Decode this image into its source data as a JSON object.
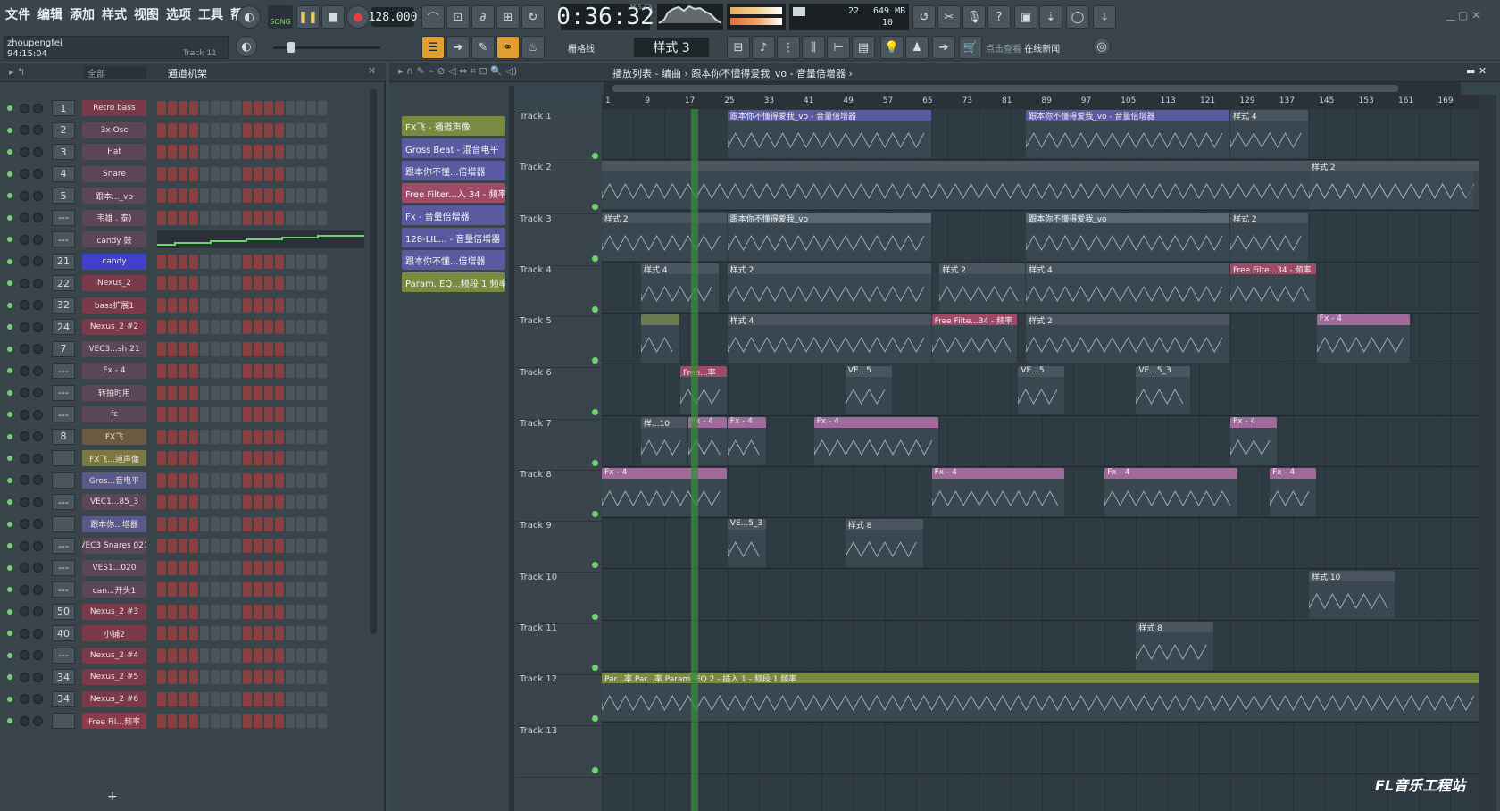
{
  "menu": [
    "文件",
    "编辑",
    "添加",
    "样式",
    "视图",
    "选项",
    "工具",
    "帮助"
  ],
  "user": {
    "name": "zhoupengfei",
    "time": "94:15:04",
    "track_hint": "Track 11"
  },
  "transport": {
    "song_label": "SONG",
    "tempo": "128.000",
    "time": "0:36:32",
    "time_sig_label": "M:S:CS",
    "pattern": "样式 3",
    "snap": "栅格线"
  },
  "cpu": {
    "voices": "22",
    "memory": "649 MB",
    "polyphony": "10"
  },
  "news": {
    "hint": "点击查看",
    "label": "在线新闻"
  },
  "rack": {
    "filter": "全部",
    "title": "通道机架"
  },
  "channels": [
    {
      "num": "1",
      "name": "Retro bass",
      "color": "#7a3a4a"
    },
    {
      "num": "2",
      "name": "3x Osc",
      "color": "#5a4656"
    },
    {
      "num": "3",
      "name": "Hat",
      "color": "#5a4656"
    },
    {
      "num": "4",
      "name": "Snare",
      "color": "#5a4656"
    },
    {
      "num": "5",
      "name": "跟本..._vo",
      "color": "#5a4656"
    },
    {
      "num": "---",
      "name": "韦雄 . 泰)",
      "color": "#5a4656"
    },
    {
      "num": "---",
      "name": "candy 鼓",
      "color": "#5a4656"
    },
    {
      "num": "21",
      "name": "candy",
      "color": "#4040c8"
    },
    {
      "num": "22",
      "name": "Nexus_2",
      "color": "#7a3a4a"
    },
    {
      "num": "32",
      "name": "bass扩展1",
      "color": "#7a3a4a"
    },
    {
      "num": "24",
      "name": "Nexus_2 #2",
      "color": "#7a3a4a"
    },
    {
      "num": "7",
      "name": "VEC3...sh 21",
      "color": "#5a4656"
    },
    {
      "num": "---",
      "name": "Fx - 4",
      "color": "#5a4656"
    },
    {
      "num": "---",
      "name": "转拍时用",
      "color": "#5a4656"
    },
    {
      "num": "---",
      "name": "fc",
      "color": "#5a4656"
    },
    {
      "num": "8",
      "name": "FX飞",
      "color": "#6a5a40"
    },
    {
      "num": "",
      "name": "FX飞...道声像",
      "color": "#7a7a40"
    },
    {
      "num": "",
      "name": "Gros...音电平",
      "color": "#5a5a8a"
    },
    {
      "num": "---",
      "name": "VEC1...85_3",
      "color": "#5a4656"
    },
    {
      "num": "",
      "name": "跟本你...增器",
      "color": "#5a5a8a"
    },
    {
      "num": "---",
      "name": "VEC3 Snares 021",
      "color": "#5a4656"
    },
    {
      "num": "---",
      "name": "VES1...020",
      "color": "#5a4656"
    },
    {
      "num": "---",
      "name": "can...开头1",
      "color": "#5a4656"
    },
    {
      "num": "50",
      "name": "Nexus_2 #3",
      "color": "#7a3a4a"
    },
    {
      "num": "40",
      "name": "小铺2",
      "color": "#7a3a4a"
    },
    {
      "num": "---",
      "name": "Nexus_2 #4",
      "color": "#7a3a4a"
    },
    {
      "num": "34",
      "name": "Nexus_2 #5",
      "color": "#7a3a4a"
    },
    {
      "num": "34",
      "name": "Nexus_2 #6",
      "color": "#7a3a4a"
    },
    {
      "num": "",
      "name": "Free Fil...频率",
      "color": "#8a3a4a"
    }
  ],
  "playlist": {
    "breadcrumb": "播放列表 - 编曲 › 跟本你不懂得爱我_vo - 音量倍增器 ›",
    "picker": [
      {
        "label": "FX飞 - 通道声像",
        "color": "#7a8a40"
      },
      {
        "label": "Gross Beat - 混音电平",
        "color": "#5a5aa0"
      },
      {
        "label": "跟本你不懂...倍增器",
        "color": "#5a5aa0"
      },
      {
        "label": "Free Filter...入 34 - 频率",
        "color": "#a04a6a"
      },
      {
        "label": "Fx - 音量倍增器",
        "color": "#5a5aa0"
      },
      {
        "label": "128-LIL... - 音量倍增器",
        "color": "#5a5aa0"
      },
      {
        "label": "跟本你不懂...倍增器",
        "color": "#5a5aa0"
      },
      {
        "label": "Param. EQ...频段 1 频率",
        "color": "#7a8a40"
      }
    ],
    "tracks": [
      "Track 1",
      "Track 2",
      "Track 3",
      "Track 4",
      "Track 5",
      "Track 6",
      "Track 7",
      "Track 8",
      "Track 9",
      "Track 10",
      "Track 11",
      "Track 12",
      "Track 13"
    ],
    "ruler": [
      "1",
      "9",
      "17",
      "25",
      "33",
      "41",
      "49",
      "57",
      "65",
      "73",
      "81",
      "89",
      "97",
      "105",
      "113",
      "121",
      "129",
      "137",
      "145",
      "153",
      "161",
      "169"
    ],
    "clips": [
      {
        "track": 0,
        "start": 16,
        "len": 26,
        "label": "跟本你不懂得爱我_vo - 音量倍增器",
        "color": "#5a5aa0"
      },
      {
        "track": 0,
        "start": 54,
        "len": 26,
        "label": "跟本你不懂得爱我_vo - 音量倍增器",
        "color": "#5a5aa0"
      },
      {
        "track": 0,
        "start": 80,
        "len": 10,
        "label": "样式 4",
        "color": "#4a5560"
      },
      {
        "track": 1,
        "start": 0,
        "len": 112,
        "label": "",
        "color": "#4a5560"
      },
      {
        "track": 1,
        "start": 90,
        "len": 21,
        "label": "样式 2",
        "color": "#4a5560"
      },
      {
        "track": 2,
        "start": 0,
        "len": 16,
        "label": "样式 2",
        "color": "#4a5560"
      },
      {
        "track": 2,
        "start": 16,
        "len": 26,
        "label": "跟本你不懂得爱我_vo",
        "color": "#5a6a78"
      },
      {
        "track": 2,
        "start": 54,
        "len": 26,
        "label": "跟本你不懂得爱我_vo",
        "color": "#5a6a78"
      },
      {
        "track": 2,
        "start": 80,
        "len": 10,
        "label": "样式 2",
        "color": "#4a5560"
      },
      {
        "track": 3,
        "start": 5,
        "len": 10,
        "label": "样式 4",
        "color": "#4a5560"
      },
      {
        "track": 3,
        "start": 16,
        "len": 26,
        "label": "样式 2",
        "color": "#4a5560"
      },
      {
        "track": 3,
        "start": 43,
        "len": 11,
        "label": "样式 2",
        "color": "#4a5560"
      },
      {
        "track": 3,
        "start": 54,
        "len": 26,
        "label": "样式 4",
        "color": "#4a5560"
      },
      {
        "track": 3,
        "start": 80,
        "len": 11,
        "label": "Free Filte...34 - 频率",
        "color": "#a04a6a"
      },
      {
        "track": 4,
        "start": 5,
        "len": 5,
        "label": "",
        "color": "#6a7a50"
      },
      {
        "track": 4,
        "start": 16,
        "len": 26,
        "label": "样式 4",
        "color": "#4a5560"
      },
      {
        "track": 4,
        "start": 42,
        "len": 11,
        "label": "Free Filte...34 - 频率",
        "color": "#a04a6a"
      },
      {
        "track": 4,
        "start": 54,
        "len": 26,
        "label": "样式 2",
        "color": "#4a5560"
      },
      {
        "track": 4,
        "start": 91,
        "len": 12,
        "label": "Fx - 4",
        "color": "#a06a9a"
      },
      {
        "track": 5,
        "start": 10,
        "len": 6,
        "label": "Free...率",
        "color": "#a04a6a"
      },
      {
        "track": 5,
        "start": 31,
        "len": 6,
        "label": "VE...5",
        "color": "#4a5560"
      },
      {
        "track": 5,
        "start": 53,
        "len": 6,
        "label": "VE...5",
        "color": "#4a5560"
      },
      {
        "track": 5,
        "start": 68,
        "len": 7,
        "label": "VE...5_3",
        "color": "#4a5560"
      },
      {
        "track": 6,
        "start": 5,
        "len": 6,
        "label": "样...10",
        "color": "#4a5560"
      },
      {
        "track": 6,
        "start": 11,
        "len": 5,
        "label": "Fx - 4",
        "color": "#a06a9a"
      },
      {
        "track": 6,
        "start": 16,
        "len": 5,
        "label": "Fx - 4",
        "color": "#a06a9a"
      },
      {
        "track": 6,
        "start": 27,
        "len": 16,
        "label": "Fx - 4",
        "color": "#a06a9a"
      },
      {
        "track": 6,
        "start": 80,
        "len": 6,
        "label": "Fx - 4",
        "color": "#a06a9a"
      },
      {
        "track": 7,
        "start": 0,
        "len": 16,
        "label": "Fx - 4",
        "color": "#a06a9a"
      },
      {
        "track": 7,
        "start": 42,
        "len": 17,
        "label": "Fx - 4",
        "color": "#a06a9a"
      },
      {
        "track": 7,
        "start": 64,
        "len": 17,
        "label": "Fx - 4",
        "color": "#a06a9a"
      },
      {
        "track": 7,
        "start": 85,
        "len": 6,
        "label": "Fx - 4",
        "color": "#a06a9a"
      },
      {
        "track": 8,
        "start": 16,
        "len": 5,
        "label": "VE...5_3",
        "color": "#4a5560"
      },
      {
        "track": 8,
        "start": 31,
        "len": 10,
        "label": "样式 8",
        "color": "#4a5560"
      },
      {
        "track": 9,
        "start": 90,
        "len": 11,
        "label": "样式 10",
        "color": "#4a5560"
      },
      {
        "track": 10,
        "start": 68,
        "len": 10,
        "label": "样式 8",
        "color": "#4a5560"
      },
      {
        "track": 11,
        "start": 0,
        "len": 112,
        "label": "Par...率  Par...率  Param. EQ 2 - 插入 1 - 频段 1 频率",
        "color": "#7a8a40"
      }
    ]
  },
  "watermark": "FL音乐工程站"
}
